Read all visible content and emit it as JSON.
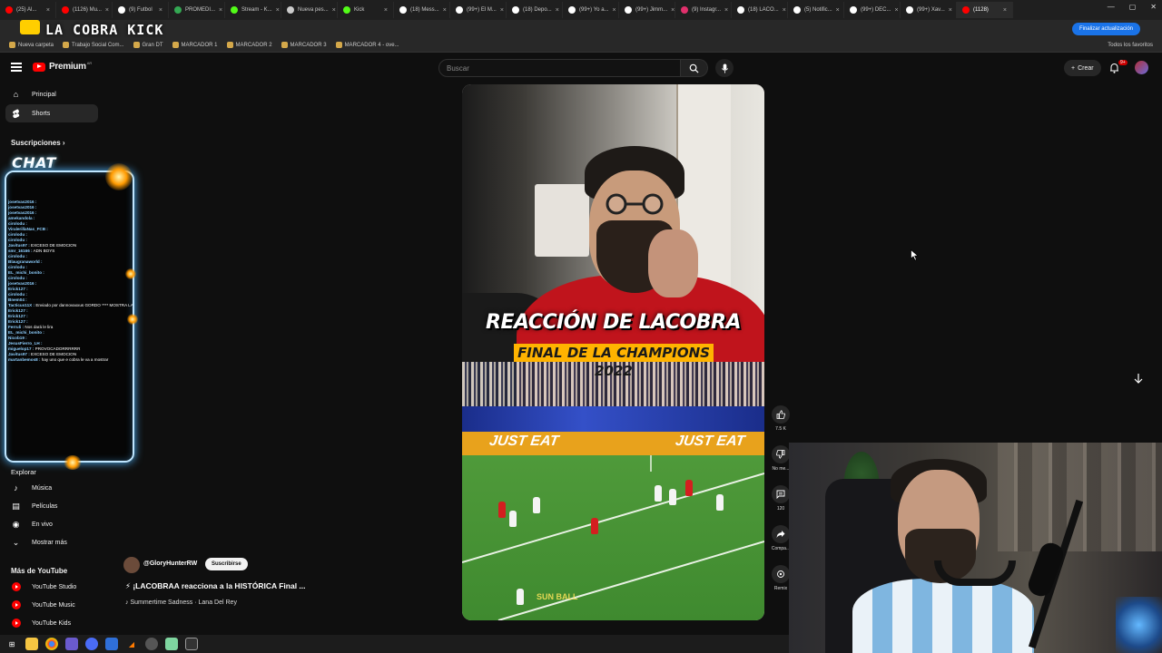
{
  "browser": {
    "tabs": [
      {
        "label": "(25) Al...",
        "color": "#ff0000"
      },
      {
        "label": "(1126) Mu...",
        "color": "#ff0000"
      },
      {
        "label": "(9) Futbol",
        "color": "#ffffff"
      },
      {
        "label": "PROMEDI...",
        "color": "#34a853"
      },
      {
        "label": "Stream - K...",
        "color": "#53fc18"
      },
      {
        "label": "Nueva pes...",
        "color": "#cccccc"
      },
      {
        "label": "Kick",
        "color": "#53fc18"
      },
      {
        "label": "(18) Mess...",
        "color": "#ffffff"
      },
      {
        "label": "(99+) El M...",
        "color": "#ffffff"
      },
      {
        "label": "(18) Depo...",
        "color": "#ffffff"
      },
      {
        "label": "(99+) Yo a...",
        "color": "#ffffff"
      },
      {
        "label": "(99+) Jimm...",
        "color": "#ffffff"
      },
      {
        "label": "(9) Instagr...",
        "color": "#e1306c"
      },
      {
        "label": "(18) LACO...",
        "color": "#ffffff"
      },
      {
        "label": "(5) Notific...",
        "color": "#ffffff"
      },
      {
        "label": "(99+) DEC...",
        "color": "#ffffff"
      },
      {
        "label": "(99+) Xav...",
        "color": "#ffffff"
      },
      {
        "label": "(1128)",
        "color": "#ff0000"
      }
    ],
    "update_button": "Finalizar actualización",
    "bookmarks": [
      "Nueva carpeta",
      "Trabajo Social Com...",
      "Gran DT",
      "MARCADOR 1",
      "MARCADOR 2",
      "MARCADOR 3",
      "MARCADOR 4 - ove..."
    ],
    "all_bookmarks": "Todos los favoritos"
  },
  "overlay": {
    "stream_title": "LA COBRA KICK",
    "chat_title": "CHAT",
    "chat_lines": [
      {
        "user": "josetvas2016 :",
        "msg": ""
      },
      {
        "user": "josetvas2016 :",
        "msg": ""
      },
      {
        "user": "josetvas2016 :",
        "msg": ""
      },
      {
        "user": "amekandola :",
        "msg": ""
      },
      {
        "user": "cirolodu :",
        "msg": ""
      },
      {
        "user": "ViralerillaNas_FCB :",
        "msg": ""
      },
      {
        "user": "cirolodu :",
        "msg": ""
      },
      {
        "user": "cirolodu :",
        "msg": ""
      },
      {
        "user": "Javitus97 :",
        "msg": "EXCESO DE EMOCION"
      },
      {
        "user": "smr_16166 :",
        "msg": "ADN BOYS"
      },
      {
        "user": "cirolodu :",
        "msg": ""
      },
      {
        "user": "Blaugranaworld :",
        "msg": ""
      },
      {
        "user": "cirolodu :",
        "msg": ""
      },
      {
        "user": "EL_michi_bonito :",
        "msg": ""
      },
      {
        "user": "cirolodu :",
        "msg": ""
      },
      {
        "user": "josetvas2016 :",
        "msg": ""
      },
      {
        "user": "Erick127 :",
        "msg": ""
      },
      {
        "user": "cirolodu :",
        "msg": ""
      },
      {
        "user": "Bnem04 :",
        "msg": ""
      },
      {
        "user": "Tacticus11X :",
        "msg": "Enviado por dannovaxxus GORDO **** MOSTRA LAS TETAS Y BAILA"
      },
      {
        "user": "Erick127 :",
        "msg": ""
      },
      {
        "user": "Erick127 :",
        "msg": ""
      },
      {
        "user": "Erick127 :",
        "msg": ""
      },
      {
        "user": "Ferruli :",
        "msg": "Nos dará le lira"
      },
      {
        "user": "EL_michi_bonito :",
        "msg": ""
      },
      {
        "user": "Nicob19 :",
        "msg": ""
      },
      {
        "user": "JesusFierro_LH :",
        "msg": ""
      },
      {
        "user": "miguelop17 :",
        "msg": "PROVOCADORRRRRR"
      },
      {
        "user": "Javitus97 :",
        "msg": "EXCESO DE EMOCION"
      },
      {
        "user": "martanbemos8 :",
        "msg": "hay uno que e cobra le va a mostrar"
      }
    ]
  },
  "youtube": {
    "logo": "Premium",
    "logo_region": "AR",
    "search_placeholder": "Buscar",
    "create_label": "Crear",
    "notif_count": "9+",
    "sidebar": {
      "items": [
        {
          "label": "Principal",
          "icon": "home-icon"
        },
        {
          "label": "Shorts",
          "icon": "shorts-icon"
        }
      ],
      "subscriptions_heading": "Suscripciones",
      "explore_heading": "Explorar",
      "explore_items": [
        {
          "label": "Música",
          "icon": "music-icon"
        },
        {
          "label": "Películas",
          "icon": "movies-icon"
        },
        {
          "label": "En vivo",
          "icon": "live-icon"
        },
        {
          "label": "Mostrar más",
          "icon": "chevron-down-icon"
        }
      ],
      "more_heading": "Más de YouTube",
      "more_items": [
        {
          "label": "YouTube Studio"
        },
        {
          "label": "YouTube Music"
        },
        {
          "label": "YouTube Kids"
        }
      ]
    },
    "short": {
      "title_main": "REACCIÓN DE LACOBRA",
      "title_sub": "FINAL DE LA CHAMPIONS 2022",
      "ad_text": "JUST EAT",
      "watermark": "SUN BALL",
      "channel": "@GloryHunterRW",
      "subscribe": "Suscribirse",
      "video_title": "⚡ ¡LACOBRAA reacciona a la HISTÓRICA Final ...",
      "music": "♪ Summertime Sadness · Lana Del Rey"
    },
    "actions": {
      "like_count": "7.5 K",
      "dislike_label": "No me...",
      "comments_count": "120",
      "share_label": "Compa...",
      "remix_label": "Remix"
    }
  }
}
